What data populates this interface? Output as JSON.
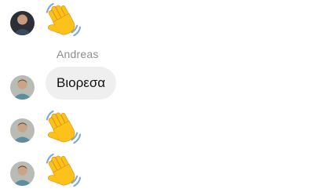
{
  "conversation": {
    "messages": [
      {
        "type": "emoji",
        "content_icon": "waving-hand-icon",
        "avatar": "avatar-dark"
      },
      {
        "type": "text",
        "sender": "Andreas",
        "text": "Βιορεσα",
        "avatar": "avatar-light"
      },
      {
        "type": "emoji",
        "content_icon": "waving-hand-icon",
        "avatar": "avatar-light"
      },
      {
        "type": "emoji",
        "content_icon": "waving-hand-icon",
        "avatar": "avatar-light"
      }
    ]
  },
  "colors": {
    "bubble_background": "#efefef",
    "sender_name": "#8e8e8e",
    "message_text": "#111111",
    "emoji_skin": "#fcc21b"
  }
}
